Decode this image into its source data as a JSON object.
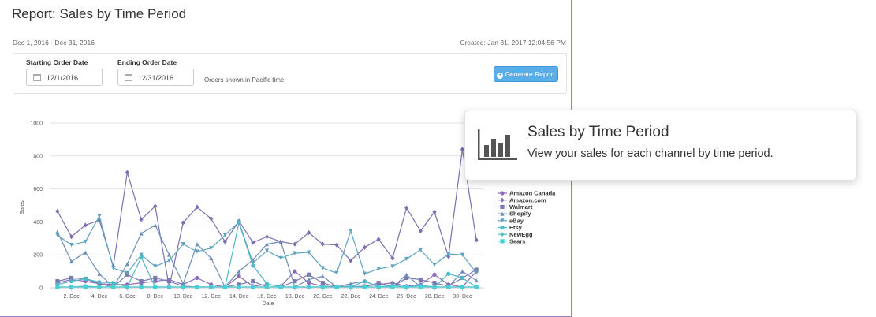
{
  "report": {
    "title": "Report: Sales by Time Period",
    "date_range": "Dec 1, 2016 - Dec 31, 2016",
    "created": "Created: Jan 31, 2017 12:04:56 PM"
  },
  "filters": {
    "start_label": "Starting Order Date",
    "start_value": "12/1/2016",
    "end_label": "Ending Order Date",
    "end_value": "12/31/2016",
    "timezone_note": "Orders shown in Pacific time",
    "generate_button": "Generate Report"
  },
  "tooltip": {
    "title": "Sales by Time Period",
    "subtitle": "View your sales for each channel by time period."
  },
  "icons": {
    "calendar": "calendar-icon",
    "generate": "plus-circle-icon",
    "feature": "bar-chart-icon"
  },
  "chart_data": {
    "type": "line",
    "xlabel": "Date",
    "ylabel": "Sales",
    "ylim": [
      0,
      1000
    ],
    "yticks": [
      0,
      200,
      400,
      600,
      800,
      1000
    ],
    "x_tick_labels": [
      "2. Dec",
      "4. Dec",
      "6. Dec",
      "8. Dec",
      "10. Dec",
      "12. Dec",
      "14. Dec",
      "16. Dec",
      "18. Dec",
      "20. Dec",
      "22. Dec",
      "24. Dec",
      "26. Dec",
      "28. Dec",
      "30. Dec"
    ],
    "x_tick_days": [
      2,
      4,
      6,
      8,
      10,
      12,
      14,
      16,
      18,
      20,
      22,
      24,
      26,
      28,
      30
    ],
    "x_days": [
      1,
      2,
      3,
      4,
      5,
      6,
      7,
      8,
      9,
      10,
      11,
      12,
      13,
      14,
      15,
      16,
      17,
      18,
      19,
      20,
      21,
      22,
      23,
      24,
      25,
      26,
      27,
      28,
      29,
      30,
      31
    ],
    "grid": true,
    "legend_position": "right",
    "series": [
      {
        "name": "Amazon Canada",
        "color": "#8e6bb8",
        "marker": "circle",
        "values": [
          30,
          50,
          40,
          25,
          20,
          20,
          30,
          40,
          50,
          20,
          60,
          20,
          5,
          70,
          10,
          20,
          10,
          100,
          30,
          10,
          5,
          5,
          10,
          20,
          30,
          10,
          20,
          80,
          20,
          5,
          100
        ]
      },
      {
        "name": "Amazon.com",
        "color": "#7d6fb0",
        "marker": "diamond",
        "values": [
          465,
          310,
          380,
          410,
          130,
          700,
          415,
          495,
          5,
          395,
          490,
          420,
          280,
          405,
          275,
          310,
          280,
          265,
          335,
          265,
          260,
          165,
          245,
          295,
          180,
          485,
          345,
          460,
          190,
          840,
          290
        ]
      },
      {
        "name": "Walmart",
        "color": "#7a7ab0",
        "marker": "square",
        "values": [
          40,
          60,
          55,
          25,
          5,
          80,
          40,
          60,
          40,
          10,
          5,
          5,
          5,
          20,
          40,
          5,
          5,
          40,
          80,
          30,
          5,
          10,
          5,
          30,
          5,
          60,
          50,
          30,
          10,
          60,
          110
        ]
      },
      {
        "name": "Shopify",
        "color": "#6f8fb8",
        "marker": "triangle",
        "values": [
          340,
          160,
          215,
          85,
          5,
          145,
          330,
          380,
          200,
          25,
          265,
          180,
          5,
          100,
          170,
          265,
          280,
          5,
          50,
          70,
          5,
          25,
          40,
          5,
          5,
          80,
          5,
          5,
          5,
          100,
          45
        ]
      },
      {
        "name": "eBay",
        "color": "#5ea3c0",
        "marker": "triangle-down",
        "values": [
          320,
          260,
          280,
          435,
          120,
          90,
          200,
          130,
          165,
          265,
          220,
          240,
          320,
          400,
          150,
          225,
          180,
          210,
          215,
          120,
          90,
          345,
          85,
          115,
          130,
          175,
          230,
          140,
          205,
          200,
          90
        ]
      },
      {
        "name": "Etsy",
        "color": "#4fb8c8",
        "marker": "circle",
        "values": [
          20,
          40,
          55,
          35,
          30,
          5,
          185,
          5,
          5,
          5,
          5,
          5,
          5,
          395,
          135,
          25,
          5,
          5,
          5,
          5,
          5,
          5,
          40,
          5,
          15,
          5,
          15,
          5,
          85,
          60,
          5
        ]
      },
      {
        "name": "NewEgg",
        "color": "#54c2c8",
        "marker": "diamond",
        "values": [
          5,
          5,
          10,
          5,
          5,
          5,
          5,
          5,
          5,
          5,
          5,
          5,
          5,
          5,
          5,
          5,
          5,
          5,
          5,
          5,
          5,
          5,
          5,
          5,
          5,
          5,
          5,
          5,
          5,
          5,
          5
        ]
      },
      {
        "name": "Sears",
        "color": "#45cfd6",
        "marker": "square",
        "values": [
          5,
          5,
          5,
          5,
          5,
          5,
          5,
          5,
          5,
          5,
          5,
          5,
          5,
          5,
          5,
          5,
          5,
          5,
          5,
          5,
          5,
          5,
          5,
          5,
          5,
          5,
          5,
          5,
          5,
          5,
          5
        ]
      }
    ]
  }
}
